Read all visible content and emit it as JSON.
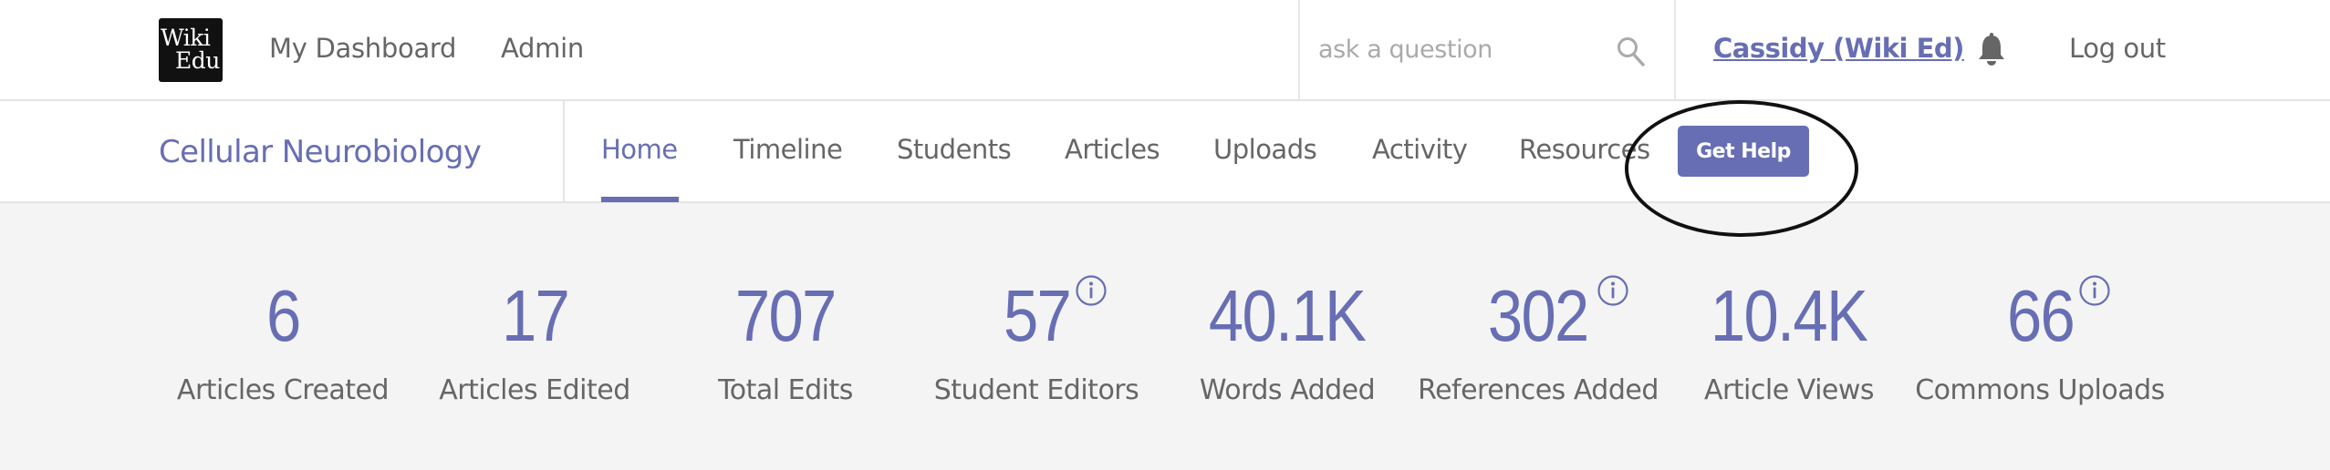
{
  "header": {
    "logo": {
      "line1": "Wiki",
      "line2": "Edu",
      "icon": "wiki-edu-logo"
    },
    "links": [
      {
        "label": "My Dashboard"
      },
      {
        "label": "Admin"
      }
    ],
    "search": {
      "placeholder": "ask a question",
      "value": "",
      "icon": "search-icon"
    },
    "user": {
      "label": "Cassidy (Wiki Ed)"
    },
    "notifications": {
      "icon": "bell-icon"
    },
    "logout": {
      "label": "Log out"
    }
  },
  "course_nav": {
    "title": "Cellular Neurobiology",
    "tabs": [
      {
        "label": "Home",
        "active": true
      },
      {
        "label": "Timeline",
        "active": false
      },
      {
        "label": "Students",
        "active": false
      },
      {
        "label": "Articles",
        "active": false
      },
      {
        "label": "Uploads",
        "active": false
      },
      {
        "label": "Activity",
        "active": false
      },
      {
        "label": "Resources",
        "active": false
      }
    ],
    "help_button": {
      "label": "Get Help"
    }
  },
  "stats": [
    {
      "value": "6",
      "label": "Articles Created",
      "info": false
    },
    {
      "value": "17",
      "label": "Articles Edited",
      "info": false
    },
    {
      "value": "707",
      "label": "Total Edits",
      "info": false
    },
    {
      "value": "57",
      "label": "Student Editors",
      "info": true
    },
    {
      "value": "40.1K",
      "label": "Words Added",
      "info": false
    },
    {
      "value": "302",
      "label": "References Added",
      "info": true
    },
    {
      "value": "10.4K",
      "label": "Article Views",
      "info": false
    },
    {
      "value": "66",
      "label": "Commons Uploads",
      "info": true
    }
  ],
  "colors": {
    "accent": "#676eb4",
    "text": "#666666",
    "background": "#f4f4f4",
    "annotation": "#111111"
  }
}
